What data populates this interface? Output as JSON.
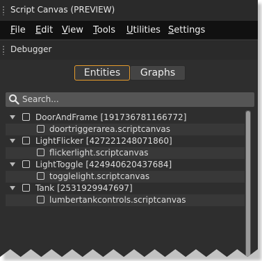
{
  "window": {
    "title": "Script Canvas (PREVIEW)"
  },
  "menu": [
    "File",
    "Edit",
    "View",
    "Tools",
    "Utilities",
    "Settings"
  ],
  "panel": {
    "title": "Debugger"
  },
  "tabs": {
    "active": "Entities",
    "inactive": "Graphs"
  },
  "search": {
    "placeholder": "Search..."
  },
  "tree": [
    {
      "entity": "DoorAndFrame [191736781166772]",
      "child": "doortriggerarea.scriptcanvas"
    },
    {
      "entity": "LightFlicker [427221248071860]",
      "child": "flickerlight.scriptcanvas"
    },
    {
      "entity": "LightToggle [424940620437684]",
      "child": "togglelight.scriptcanvas"
    },
    {
      "entity": "Tank [2531929947697]",
      "child": "lumbertankcontrols.scriptcanvas"
    }
  ],
  "colors": {
    "accent": "#e59b2c",
    "background": "#2e2e2e",
    "menubar": "#111111"
  }
}
